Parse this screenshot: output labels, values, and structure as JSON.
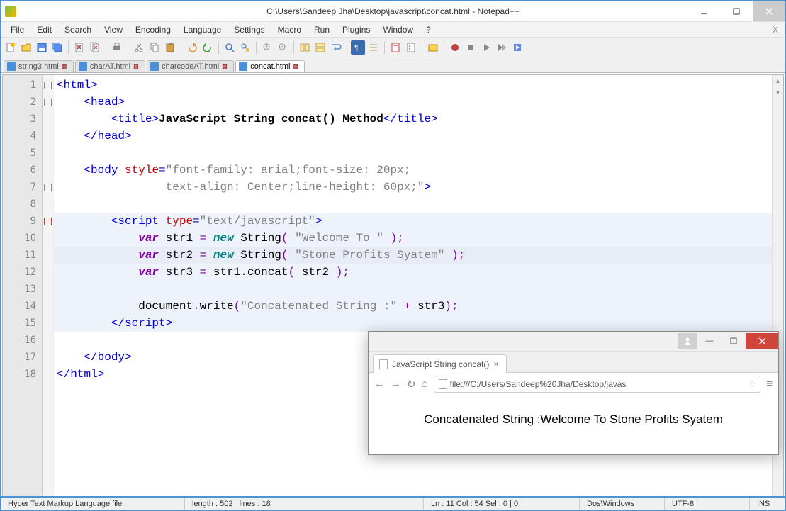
{
  "window": {
    "title": "C:\\Users\\Sandeep Jha\\Desktop\\javascript\\concat.html - Notepad++"
  },
  "menu": [
    "File",
    "Edit",
    "Search",
    "View",
    "Encoding",
    "Language",
    "Settings",
    "Macro",
    "Run",
    "Plugins",
    "Window",
    "?"
  ],
  "tabs": [
    {
      "label": "string3.html",
      "active": false
    },
    {
      "label": "charAT.html",
      "active": false
    },
    {
      "label": "charcodeAT.html",
      "active": false
    },
    {
      "label": "concat.html",
      "active": true
    }
  ],
  "code": {
    "title_text": "JavaScript String concat() Method",
    "style_val1": "\"font-family: arial;font-size: 20px;",
    "style_val2": "text-align: Center;line-height: 60px;\"",
    "script_type": "\"text/javascript\"",
    "str1_val": "\"Welcome To \"",
    "str2_val": "\"Stone Profits Syatem\"",
    "concat_str": "\"Concatenated String :\"",
    "tags": {
      "html_o": "<html>",
      "html_c": "</html>",
      "head_o": "<head>",
      "head_c": "</head>",
      "title_o": "<title>",
      "title_c": "</title>",
      "body_o": "<body",
      "body_c": "</body>",
      "script_o": "<script",
      "script_c": "</script>"
    },
    "attrs": {
      "style": "style",
      "type": "type"
    },
    "kw": {
      "var": "var",
      "new": "new"
    },
    "ids": {
      "str1": "str1",
      "str2": "str2",
      "str3": "str3",
      "StringC": "String",
      "concat": "concat",
      "doc": "document",
      "write": "write"
    }
  },
  "status": {
    "lang": "Hyper Text Markup Language file",
    "length": "length : 502",
    "lines": "lines : 18",
    "pos": "Ln : 11    Col : 54    Sel : 0 | 0",
    "eol": "Dos\\Windows",
    "enc": "UTF-8",
    "ins": "INS"
  },
  "browser": {
    "tab_title": "JavaScript String concat()",
    "url": "file:///C:/Users/Sandeep%20Jha/Desktop/javas",
    "output": "Concatenated String :Welcome To Stone Profits Syatem"
  }
}
